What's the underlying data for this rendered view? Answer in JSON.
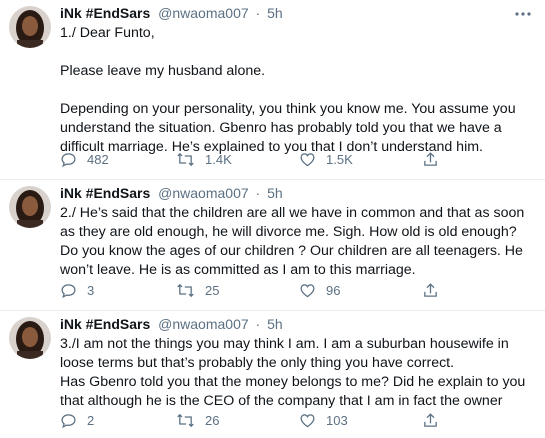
{
  "tweets": [
    {
      "name": "iNk #EndSars",
      "handle": "@nwaoma007",
      "separator": "·",
      "time": "5h",
      "paragraphs": [
        "1./ Dear Funto,",
        "Please leave my husband alone.",
        "Depending on your personality, you think you know me. You assume you understand the situation. Gbenro has probably told you that we have a difficult marriage. He’s explained to you that I don’t understand him."
      ],
      "replies": "482",
      "retweets": "1.4K",
      "likes": "1.5K"
    },
    {
      "name": "iNk #EndSars",
      "handle": "@nwaoma007",
      "separator": "·",
      "time": "5h",
      "paragraphs": [
        "2./ He’s said that the children are all we have in common and that as soon as they are old enough, he will divorce me. Sigh. How old is old enough? Do you know the ages of our children ? Our children are all teenagers. He won’t leave. He is as committed as I am to this marriage."
      ],
      "replies": "3",
      "retweets": "25",
      "likes": "96"
    },
    {
      "name": "iNk #EndSars",
      "handle": "@nwaoma007",
      "separator": "·",
      "time": "5h",
      "paragraphs": [
        "3./I am not the things you may think I am. I am a suburban housewife in loose terms but that’s probably the only thing you have correct.",
        "Has Gbenro told you that the money belongs to me? Did he explain to you that although he is the CEO of the company that I am in fact the owner"
      ],
      "replies": "2",
      "retweets": "26",
      "likes": "103"
    }
  ],
  "icons": {
    "more": "more-dots-icon",
    "reply": "reply-bubble-icon",
    "retweet": "retweet-icon",
    "like": "heart-icon",
    "share": "share-icon"
  },
  "colors": {
    "text": "#0f1419",
    "secondary": "#5b7083",
    "divider": "#e6ecf0"
  }
}
